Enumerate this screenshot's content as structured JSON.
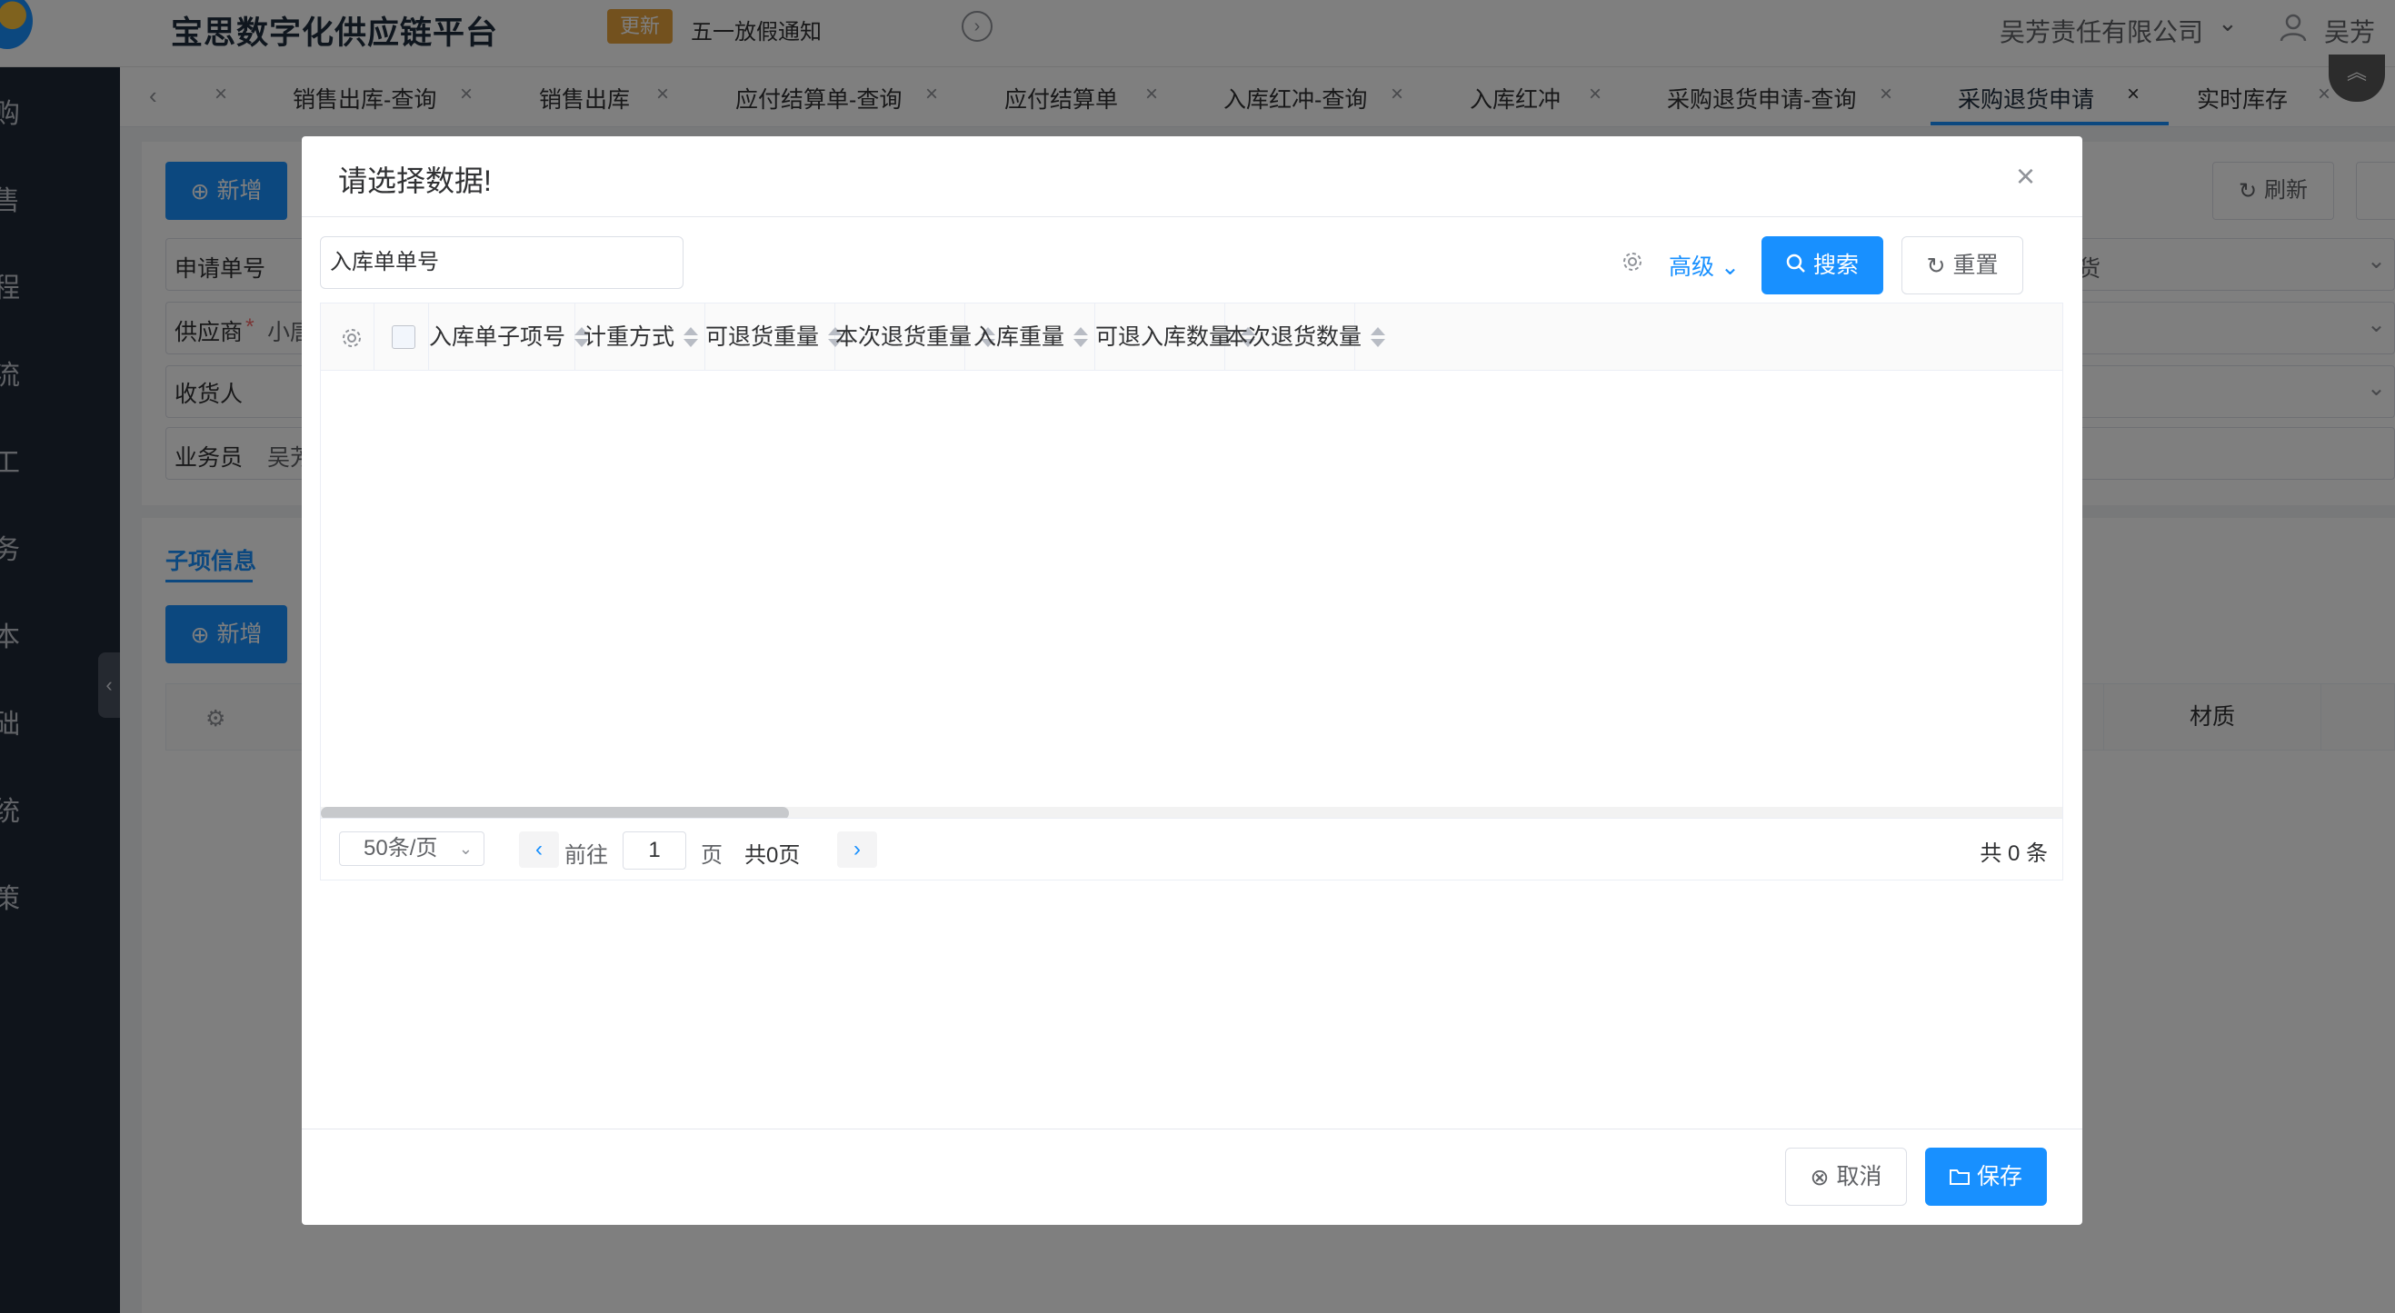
{
  "header": {
    "app_title": "宝思数字化供应链平台",
    "update_badge": "更新",
    "notice": "五一放假通知",
    "company": "吴芳责任有限公司",
    "user": "吴芳"
  },
  "sidebar": {
    "items": [
      "购",
      "售",
      "程",
      "流",
      "工",
      "务",
      "本",
      "础",
      "统",
      "策"
    ]
  },
  "tabs": {
    "items": [
      {
        "label": "销售出库-查询"
      },
      {
        "label": "销售出库"
      },
      {
        "label": "应付结算单-查询"
      },
      {
        "label": "应付结算单"
      },
      {
        "label": "入库红冲-查询"
      },
      {
        "label": "入库红冲"
      },
      {
        "label": "采购退货申请-查询"
      },
      {
        "label": "采购退货申请"
      },
      {
        "label": "实时库存"
      }
    ],
    "active_index": 7
  },
  "background_page": {
    "add_button": "新增",
    "refresh_button": "刷新",
    "fields": {
      "apply_no": "申请单号",
      "supplier": "供应商",
      "supplier_value": "小唐",
      "consignee": "收货人",
      "salesman": "业务员",
      "salesman_value": "吴芳",
      "right_field_value": "货"
    },
    "subitem_tab": "子项信息",
    "subitem_add_button": "新增",
    "subitem_column": "材质"
  },
  "dialog": {
    "title": "请选择数据!",
    "search_placeholder": "入库单单号",
    "advanced": "高级",
    "search_button": "搜索",
    "reset_button": "重置",
    "columns": [
      "入库单子项号",
      "计重方式",
      "可退货重量",
      "本次退货重量",
      "入库重量",
      "可退入库数量",
      "本次退货数量"
    ],
    "rows": [],
    "pagination": {
      "page_size": "50条/页",
      "goto_label": "前往",
      "current_page": "1",
      "page_unit": "页",
      "total_pages": "共0页",
      "total_count": "共 0 条"
    },
    "cancel_button": "取消",
    "save_button": "保存"
  },
  "colors": {
    "primary": "#1890ff",
    "sidebar": "#1f2937",
    "badge": "#e6a23c"
  },
  "icons": [
    "logo",
    "chevron-right-circle-icon",
    "chevron-down-icon",
    "user-icon",
    "close-icon",
    "gear-icon",
    "search-icon",
    "refresh-icon",
    "folder-icon",
    "cancel-circle-icon",
    "plus-circle-icon"
  ]
}
